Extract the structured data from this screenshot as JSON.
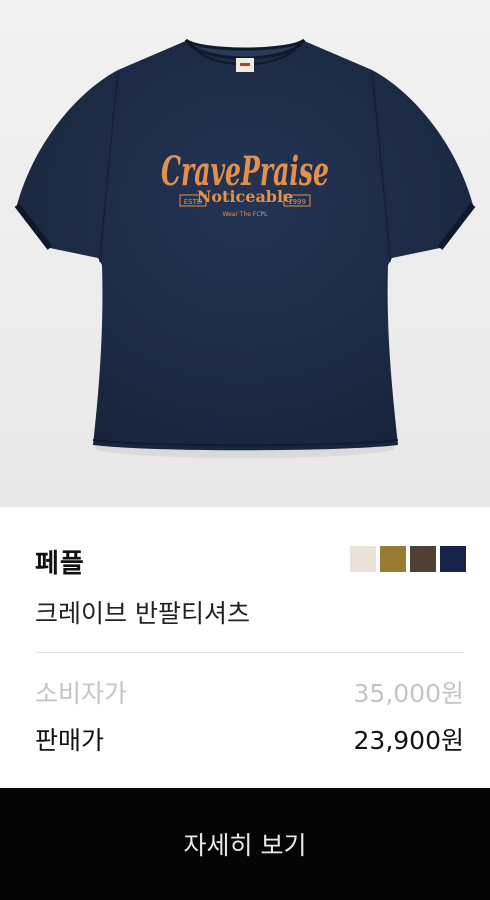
{
  "product": {
    "image_alt": "Navy short-sleeve t-shirt with orange script print",
    "print": {
      "script_text": "CravePraise",
      "sub_text": "Noticeable",
      "left_tag": "ESTD",
      "right_tag": "1999",
      "tagline": "Wear The FCPL"
    },
    "brand": "페플",
    "name": "크레이브 반팔티셔츠",
    "swatches": [
      {
        "color_name": "ivory",
        "hex": "#e8e2d8"
      },
      {
        "color_name": "mustard",
        "hex": "#9a7b32"
      },
      {
        "color_name": "brown",
        "hex": "#4f4035"
      },
      {
        "color_name": "navy",
        "hex": "#18224a"
      }
    ],
    "msrp": {
      "label": "소비자가",
      "value": "35,000원"
    },
    "sale": {
      "label": "판매가",
      "value": "23,900원"
    }
  },
  "cta": {
    "label": "자세히 보기"
  },
  "colors": {
    "shirt": "#1c2a44",
    "print": "#e2904b",
    "button_bg": "#050505"
  }
}
